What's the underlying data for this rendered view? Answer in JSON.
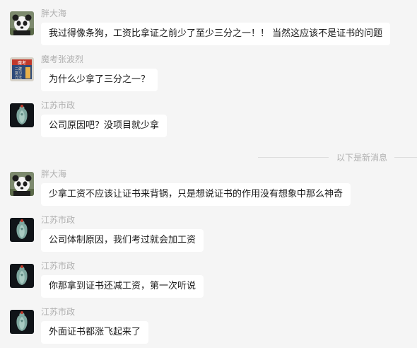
{
  "messages": [
    {
      "sender": "胖大海",
      "avatar": "panda-avatar",
      "text": "我过得像条狗，工资比拿证之前少了至少三分之一！！ 当然这应该不是证书的问题"
    },
    {
      "sender": "魔考张波烈",
      "avatar": "book-avatar",
      "text": "为什么少拿了三分之一？"
    },
    {
      "sender": "江苏市政",
      "avatar": "jade-avatar",
      "text": "公司原因吧？没项目就少拿"
    },
    {
      "sender": "胖大海",
      "avatar": "panda-avatar",
      "text": "少拿工资不应该让证书来背锅，只是想说证书的作用没有想象中那么神奇"
    },
    {
      "sender": "江苏市政",
      "avatar": "jade-avatar",
      "text": "公司体制原因，我们考过就会加工资"
    },
    {
      "sender": "江苏市政",
      "avatar": "jade-avatar",
      "text": "你那拿到证书还减工资，第一次听说"
    },
    {
      "sender": "江苏市政",
      "avatar": "jade-avatar",
      "text": "外面证书都涨飞起来了"
    }
  ],
  "divider": {
    "label": "以下是新消息"
  },
  "book_cover": {
    "title": "魔考",
    "lines": [
      "二建",
      "复习",
      "方法"
    ]
  }
}
